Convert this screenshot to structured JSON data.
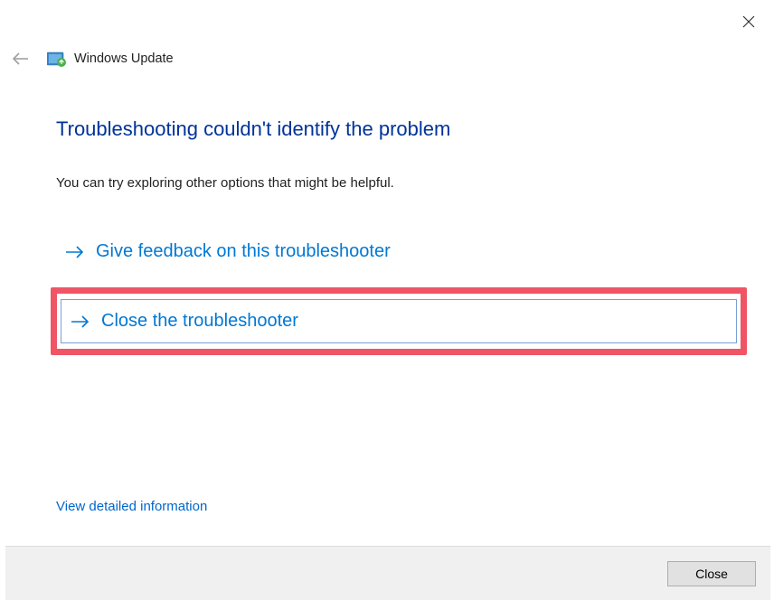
{
  "header": {
    "title": "Windows Update"
  },
  "main": {
    "heading": "Troubleshooting couldn't identify the problem",
    "subtext": "You can try exploring other options that might be helpful.",
    "options": [
      {
        "label": "Give feedback on this troubleshooter"
      },
      {
        "label": "Close the troubleshooter"
      }
    ],
    "detailed_link": "View detailed information"
  },
  "footer": {
    "close_label": "Close"
  }
}
